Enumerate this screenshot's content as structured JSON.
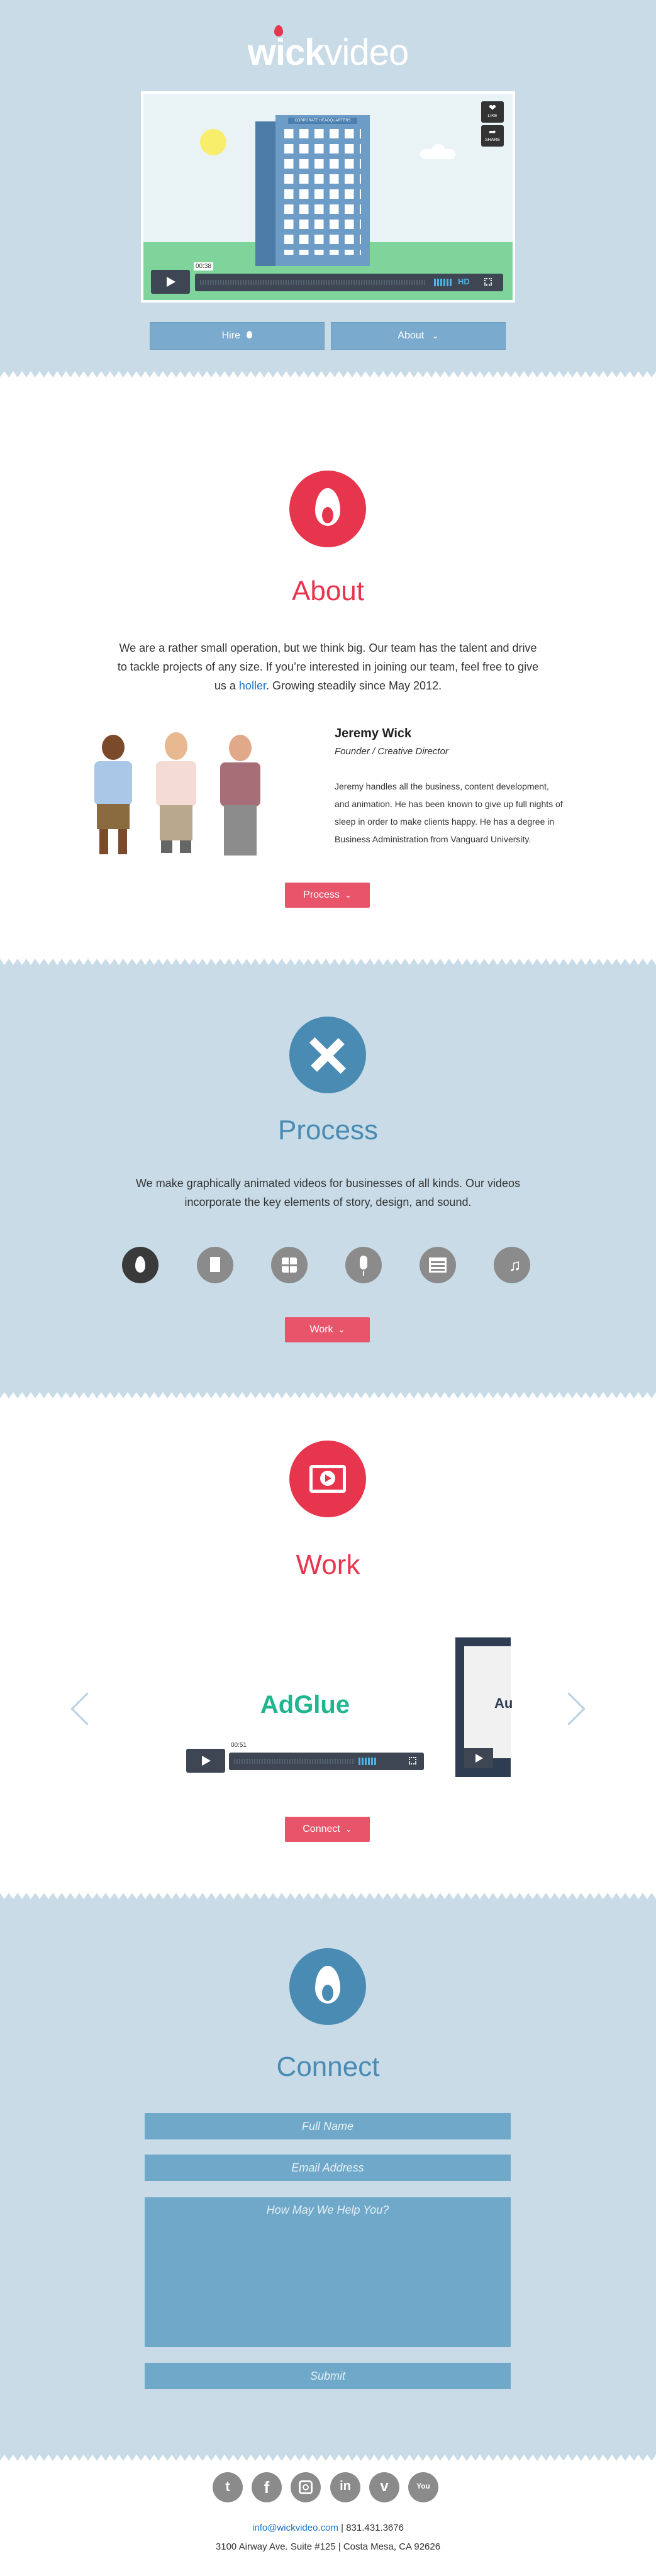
{
  "header": {
    "logo_bold": "wick",
    "logo_light": "video",
    "video": {
      "building_sign": "CORPORATE HEADQUARTERS",
      "like_label": "LIKE",
      "share_label": "SHARE",
      "time": "00:38",
      "hd": "HD"
    },
    "hire_label": "Hire",
    "about_label": "About"
  },
  "about": {
    "title": "About",
    "para1": "We are a rather small operation, but we think big. Our team has the talent and drive",
    "para2": "to tackle projects of any size. If you’re interested in joining our team, feel free to give",
    "para3_pre": "us a ",
    "para3_link": "holler",
    "para3_post": ". Growing steadily since May 2012.",
    "person_name": "Jeremy Wick",
    "person_role": "Founder / Creative Director",
    "bio1": "Jeremy handles all the business, content development,",
    "bio2": "and animation. He has been known to give up full nights of",
    "bio3": "sleep in order to make clients happy. He has a degree in",
    "bio4": "Business Administration from Vanguard University.",
    "button": "Process"
  },
  "process": {
    "title": "Process",
    "line1": "We make graphically animated videos for businesses of all kinds. Our videos",
    "line2": "incorporate the key elements of story, design, and sound.",
    "button": "Work",
    "icons": [
      "flame-icon",
      "document-icon",
      "grid-icon",
      "microphone-icon",
      "film-icon",
      "music-icon"
    ]
  },
  "work": {
    "title": "Work",
    "adglue": "AdGlue",
    "time": "00:51",
    "next_card_text": "Au",
    "button": "Connect"
  },
  "connect": {
    "title": "Connect",
    "name_placeholder": "Full Name",
    "email_placeholder": "Email Address",
    "message_placeholder": "How May We Help You?",
    "submit": "Submit"
  },
  "footer": {
    "email": "info@wickvideo.com",
    "phone": " | 831.431.3676",
    "address": "3100 Airway Ave. Suite #125 | Costa Mesa, CA 92626",
    "social": [
      "twitter-icon",
      "facebook-icon",
      "instagram-icon",
      "linkedin-icon",
      "vimeo-icon",
      "youtube-icon"
    ]
  },
  "colors": {
    "accent_red": "#e8354e",
    "accent_blue": "#4a8bb4",
    "section_blue": "#c8dbe7"
  }
}
